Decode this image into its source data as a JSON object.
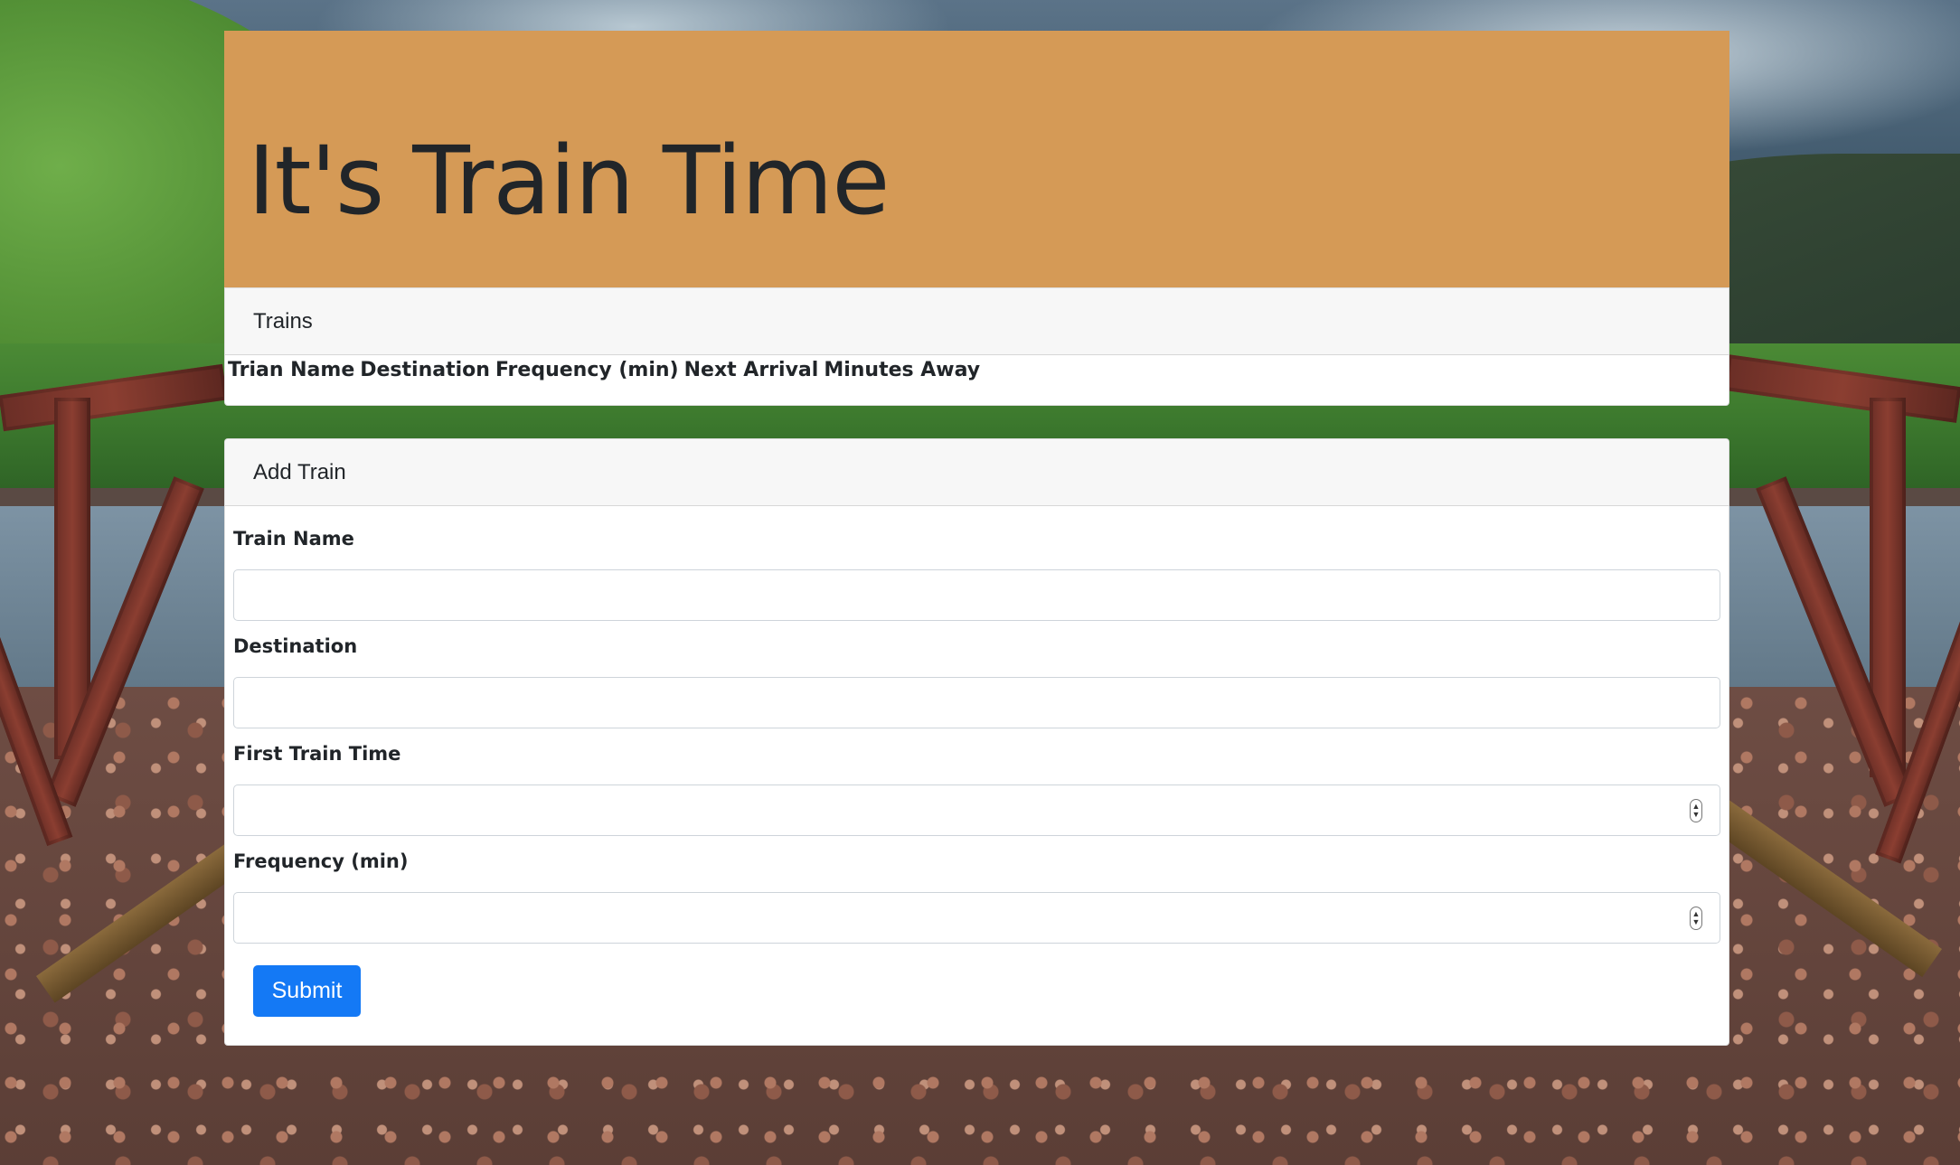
{
  "jumbotron": {
    "title": "It's Train Time"
  },
  "trains_panel": {
    "header": "Trains",
    "columns": [
      "Trian Name",
      "Destination",
      "Frequency (min)",
      "Next Arrival",
      "Minutes Away"
    ]
  },
  "add_train_panel": {
    "header": "Add Train",
    "fields": {
      "train_name": {
        "label": "Train Name",
        "value": ""
      },
      "destination": {
        "label": "Destination",
        "value": ""
      },
      "first_train_time": {
        "label": "First Train Time",
        "value": ""
      },
      "frequency": {
        "label": "Frequency (min)",
        "value": ""
      }
    },
    "submit_label": "Submit"
  },
  "colors": {
    "jumbotron_bg": "#d59a56",
    "primary_button": "#1479f5"
  },
  "icons": {
    "spinner": "number-spinner-icon"
  }
}
